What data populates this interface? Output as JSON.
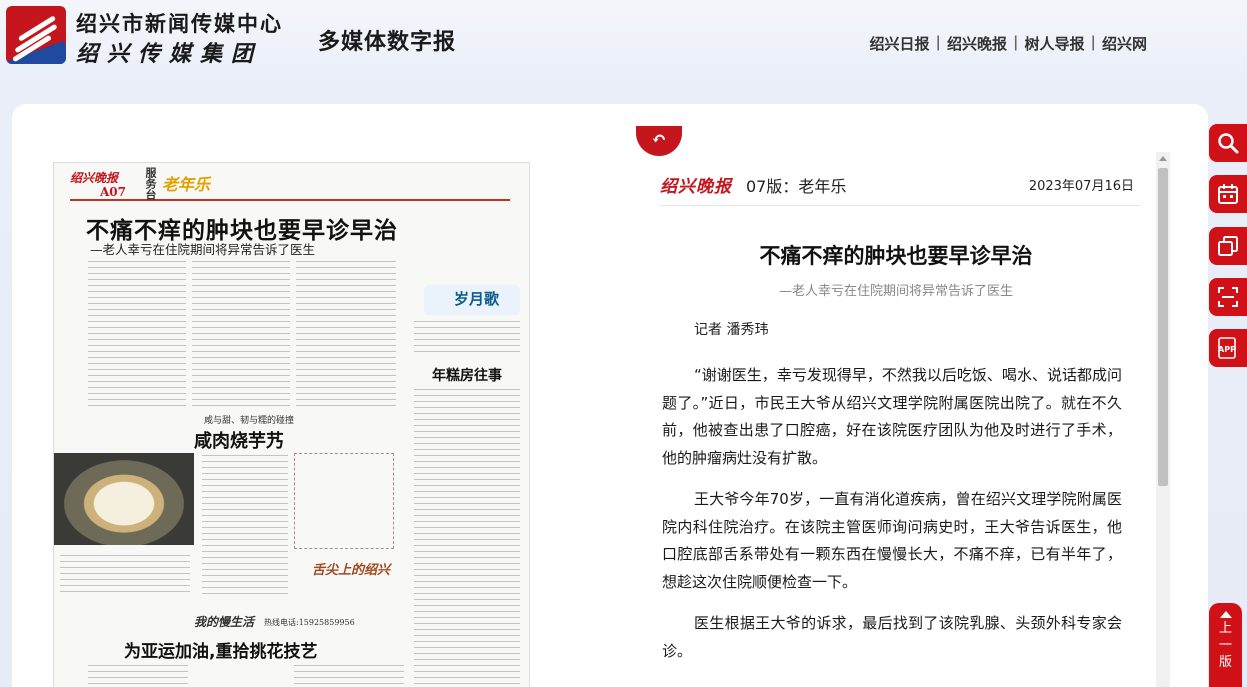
{
  "header": {
    "org_line1": "绍兴市新闻传媒中心",
    "org_line2": "绍兴传媒集团",
    "digital_title": "多媒体数字报",
    "nav": [
      "绍兴日报",
      "绍兴晚报",
      "树人导报",
      "绍兴网"
    ],
    "nav_separator": "|"
  },
  "newspaper_page": {
    "logo": "绍兴晚报",
    "section_code": "A07",
    "column_label": "服务台",
    "column_brand": "老年乐",
    "headline": "不痛不痒的肿块也要早诊早治",
    "subhead": "—老人幸亏在住院期间将异常告诉了医生",
    "song_badge": "岁月歌",
    "story2_title": "年糕房往事",
    "dish_kicker": "咸与甜、韧与糯的碰撞",
    "dish_title": "咸肉烧芋艿",
    "brush_caption": "舌尖上的绍兴",
    "life_column": "我的慢生活",
    "phone": "热线电话:15925859956",
    "headline3": "为亚运加油,重拾挑花技艺"
  },
  "article": {
    "back_label": "↶",
    "paper_logo": "绍兴晚报",
    "edition": "07版：老年乐",
    "date": "2023年07月16日",
    "title": "不痛不痒的肿块也要早诊早治",
    "subtitle": "—老人幸亏在住院期间将异常告诉了医生",
    "byline": "记者 潘秀玮",
    "paragraphs": [
      "“谢谢医生，幸亏发现得早，不然我以后吃饭、喝水、说话都成问题了。”近日，市民王大爷从绍兴文理学院附属医院出院了。就在不久前，他被查出患了口腔癌，好在该院医疗团队为他及时进行了手术，他的肿瘤病灶没有扩散。",
      "王大爷今年70岁，一直有消化道疾病，曾在绍兴文理学院附属医院内科住院治疗。在该院主管医师询问病史时，王大爷告诉医生，他口腔底部舌系带处有一颗东西在慢慢长大，不痛不痒，已有半年了，想趁这次住院顺便检查一下。",
      "医生根据王大爷的诉求，最后找到了该院乳腺、头颈外科专家会诊。"
    ]
  },
  "sidebar_tools": [
    {
      "name": "search-icon"
    },
    {
      "name": "calendar-icon"
    },
    {
      "name": "copy-icon"
    },
    {
      "name": "scan-icon"
    },
    {
      "name": "app-icon",
      "label": "APP"
    }
  ],
  "prev_page_label": "上一版",
  "colors": {
    "brand_red": "#c4161c",
    "toolbar_red": "#d01117",
    "background": "#e9eef8"
  }
}
